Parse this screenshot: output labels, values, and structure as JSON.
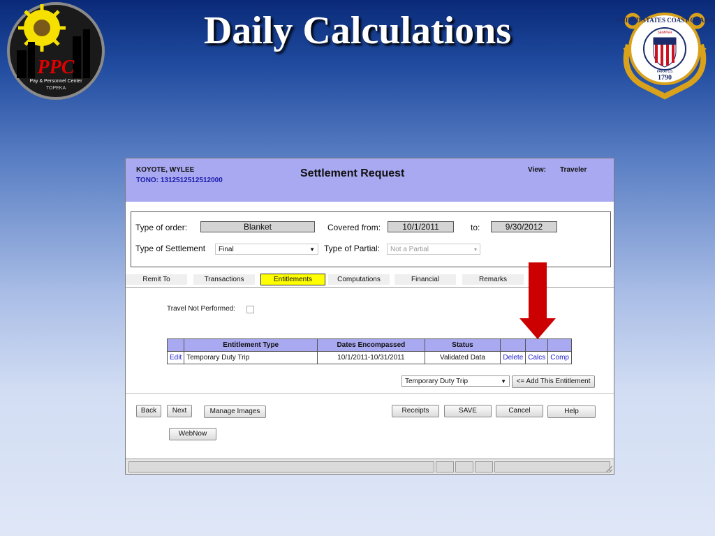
{
  "slide": {
    "title": "Daily Calculations",
    "left_logo": {
      "text_main": "PPC",
      "text_sub": "Pay & Personnel Center",
      "text_city": "TOPEKA"
    },
    "right_logo": {
      "text_top": "UNITED STATES COAST GUARD",
      "text_semper": "SEMPER",
      "text_paratus": "PARATUS",
      "text_year": "1790"
    }
  },
  "window": {
    "header": {
      "member_name": "KOYOTE, WYLEE",
      "tono": "TONO: 1312512512512000",
      "title": "Settlement Request",
      "view_label": "View:",
      "view_value": "Traveler"
    },
    "order": {
      "type_of_order_label": "Type of order:",
      "type_of_order_value": "Blanket",
      "covered_from_label": "Covered from:",
      "covered_from_value": "10/1/2011",
      "to_label": "to:",
      "to_value": "9/30/2012",
      "type_of_settlement_label": "Type of Settlement",
      "type_of_settlement_value": "Final",
      "type_of_partial_label": "Type of Partial:",
      "type_of_partial_value": "Not a Partial"
    },
    "tabs": [
      {
        "label": "Remit To"
      },
      {
        "label": "Transactions"
      },
      {
        "label": "Entitlements",
        "active": true
      },
      {
        "label": "Computations"
      },
      {
        "label": "Financial"
      },
      {
        "label": "Remarks"
      }
    ],
    "travel_not_performed_label": "Travel Not Performed:",
    "travel_not_performed_checked": false,
    "entitlements_table": {
      "headers": [
        "Entitlement Type",
        "Dates Encompassed",
        "Status"
      ],
      "rows": [
        {
          "edit": "Edit",
          "type": "Temporary Duty Trip",
          "dates": "10/1/2011-10/31/2011",
          "status": "Validated Data",
          "delete": "Delete",
          "calcs": "Calcs",
          "comp": "Comp"
        }
      ]
    },
    "add_entitlement": {
      "select_value": "Temporary Duty Trip",
      "button_label": "<= Add This Entitlement"
    },
    "buttons": {
      "back": "Back",
      "next": "Next",
      "manage_images": "Manage Images",
      "receipts": "Receipts",
      "save": "SAVE",
      "cancel": "Cancel",
      "help": "Help",
      "webnow": "WebNow"
    }
  },
  "colors": {
    "header_bg": "#a9a9f2",
    "active_tab": "#ffff00",
    "arrow": "#cc0000",
    "link": "#1a1ad0"
  },
  "icons": [
    "ppc-logo",
    "coast-guard-seal",
    "red-down-arrow",
    "dropdown-arrow-icon",
    "resize-grip-icon"
  ]
}
